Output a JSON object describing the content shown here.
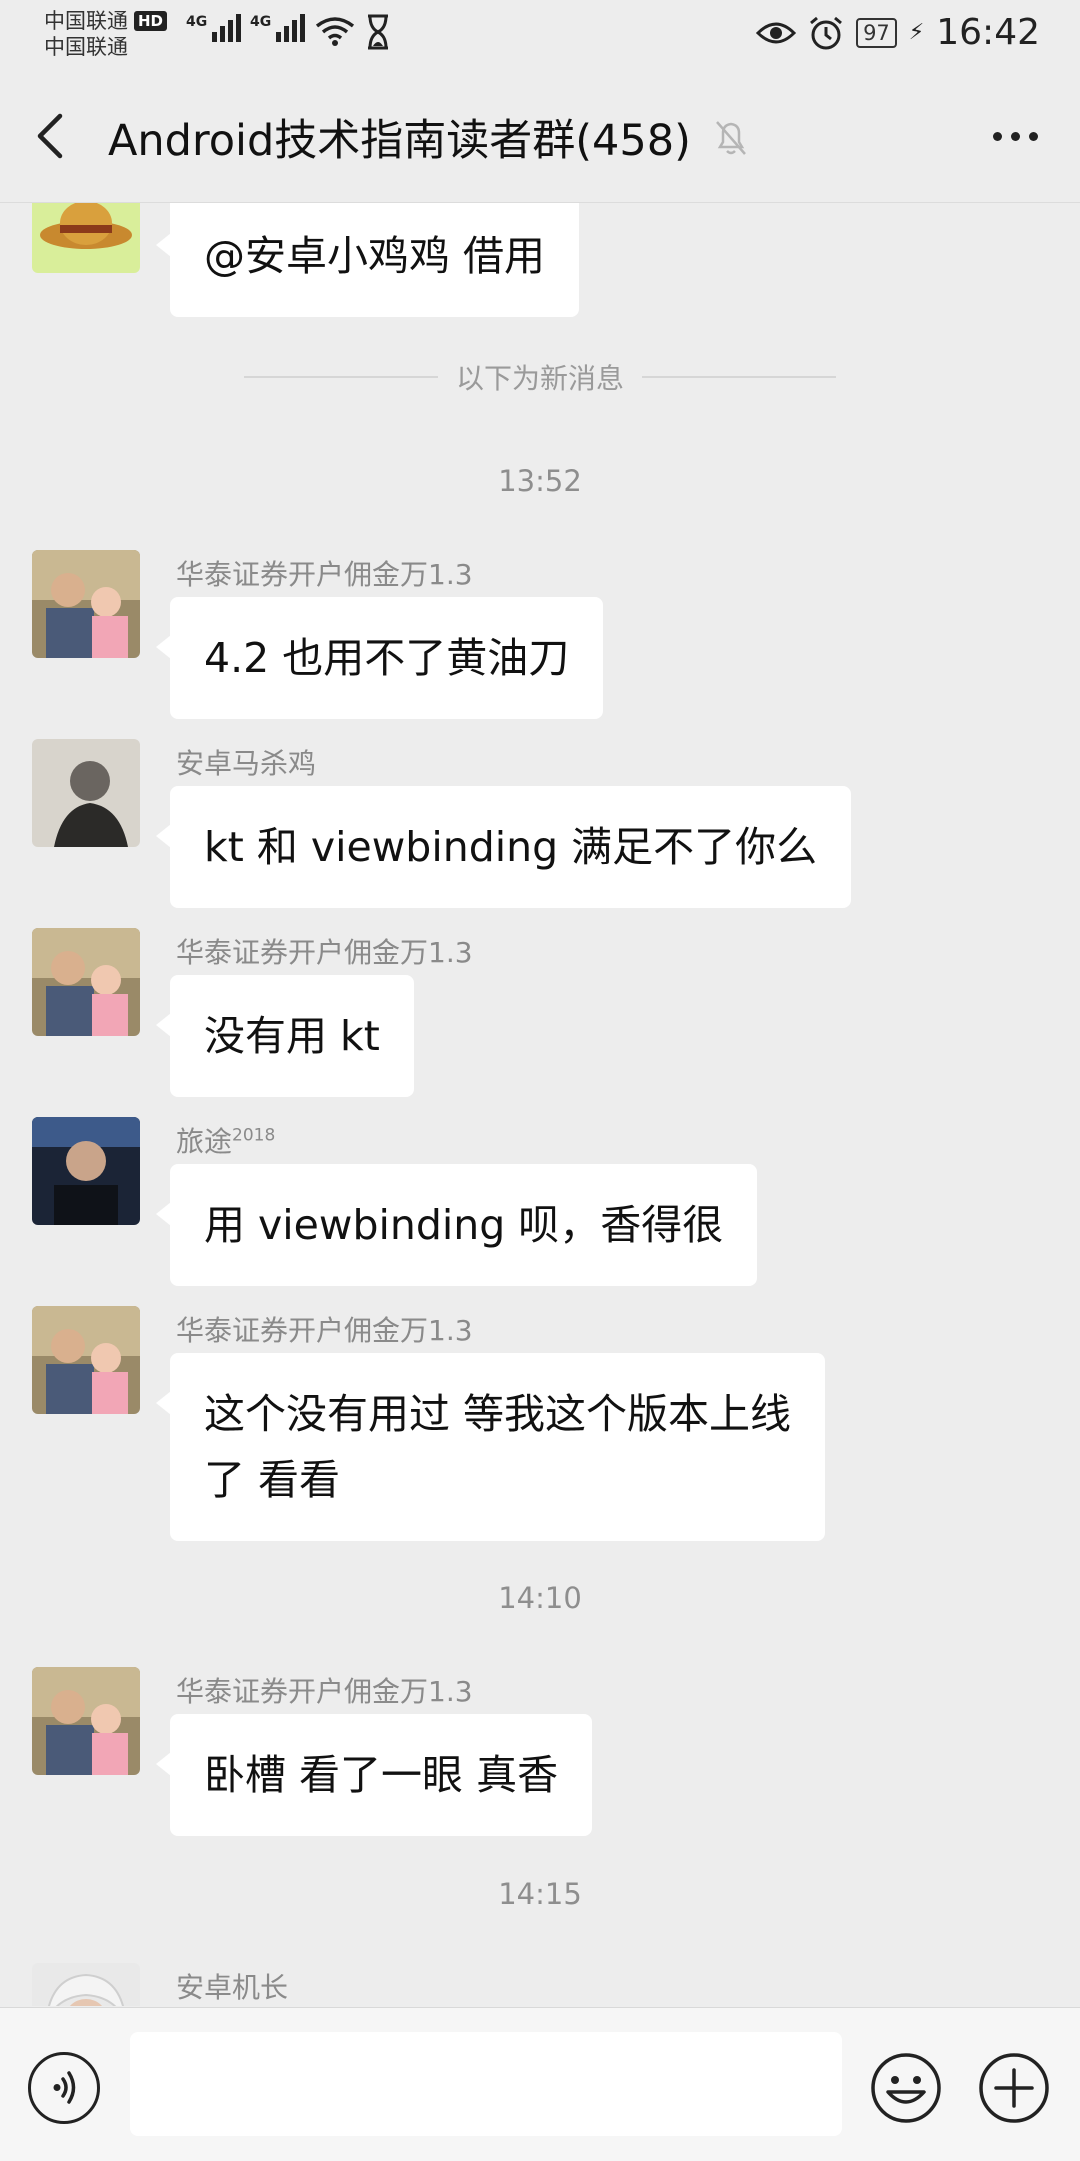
{
  "status_bar": {
    "carrier1": "中国联通",
    "hd_badge": "HD",
    "carrier2": "中国联通",
    "network1": "4G",
    "network2": "4G",
    "battery": "97",
    "time": "16:42"
  },
  "header": {
    "title": "Android技术指南读者群(458)"
  },
  "messages_top": {
    "partial_text": "@安卓小鸡鸡  借用"
  },
  "new_messages_divider": "以下为新消息",
  "timestamps": [
    "13:52",
    "14:10",
    "14:15"
  ],
  "messages": [
    {
      "sender": "华泰证券开户佣金万1.3",
      "lines": [
        "4.2 也用不了黄油刀"
      ]
    },
    {
      "sender": "安卓马杀鸡",
      "lines": [
        "kt 和 viewbinding 满足不了你么"
      ]
    },
    {
      "sender": "华泰证券开户佣金万1.3",
      "lines": [
        "没有用 kt"
      ]
    },
    {
      "sender": "旅途",
      "sender_sup": "2018",
      "lines": [
        "用 viewbinding 呗，香得很"
      ]
    },
    {
      "sender": "华泰证券开户佣金万1.3",
      "lines": [
        "这个没有用过 等我这个版本上线",
        "了 看看"
      ]
    },
    {
      "sender": "华泰证券开户佣金万1.3",
      "lines": [
        "卧槽 看了一眼 真香"
      ]
    },
    {
      "sender": "安卓机长",
      "lines": []
    }
  ],
  "input": {
    "value": "",
    "placeholder": ""
  },
  "icons": {
    "back": "back-arrow-icon",
    "mute": "mute-bell-icon",
    "more": "more-dots-icon",
    "voice": "voice-icon",
    "emoji": "emoji-icon",
    "plus": "plus-icon"
  }
}
